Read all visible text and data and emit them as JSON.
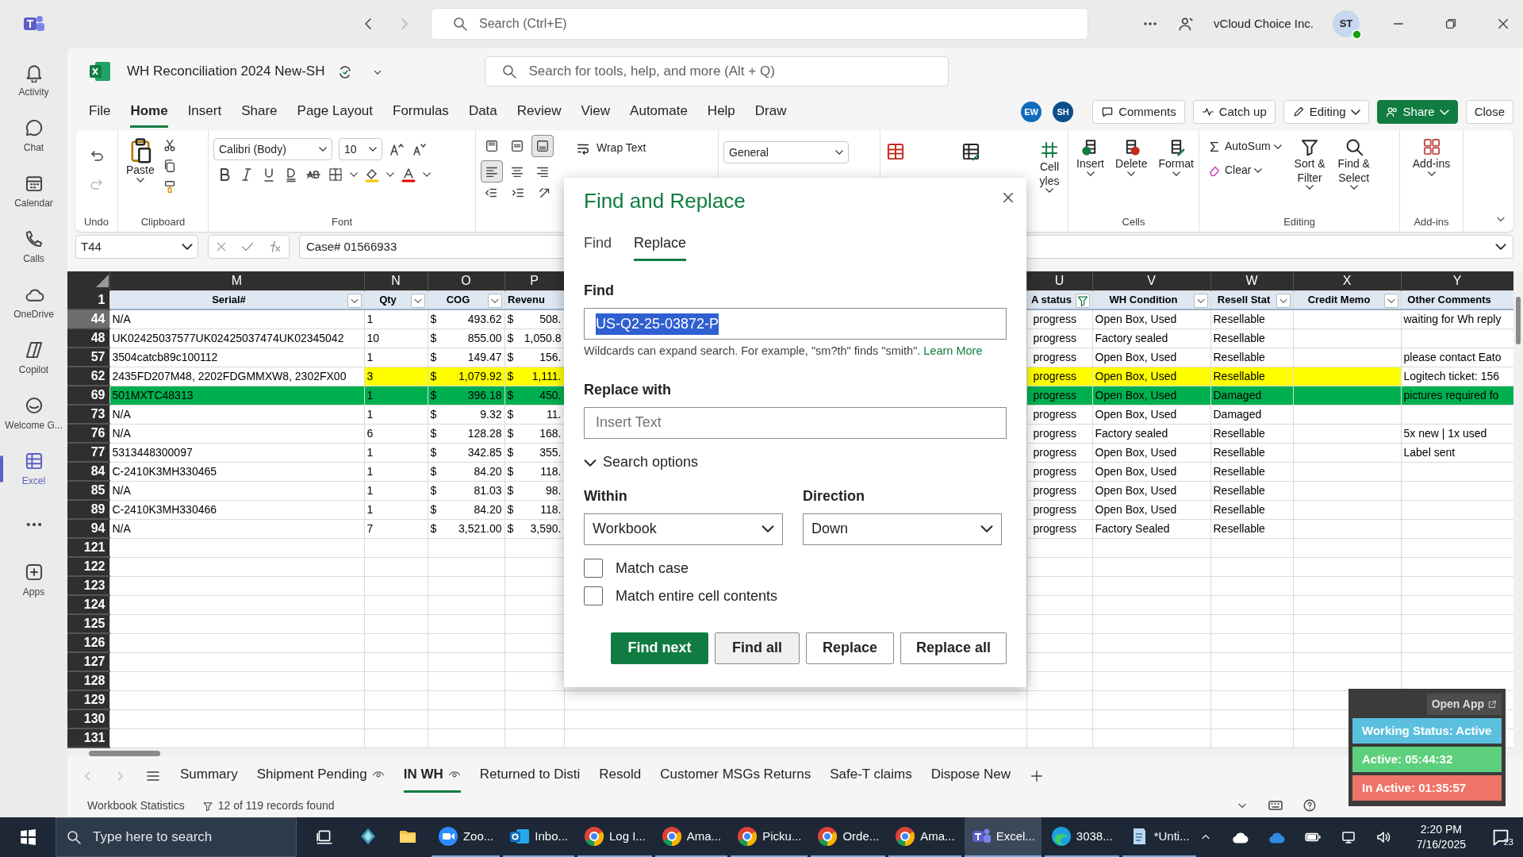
{
  "teams_titlebar": {
    "search_placeholder": "Search (Ctrl+E)",
    "organization": "vCloud Choice Inc.",
    "avatar": "ST"
  },
  "teams_rail": [
    {
      "kind": "app",
      "label": "Activity",
      "selected": false
    },
    {
      "kind": "app",
      "label": "Chat",
      "selected": false
    },
    {
      "kind": "app",
      "label": "Calendar",
      "selected": false
    },
    {
      "kind": "app",
      "label": "Calls",
      "selected": false
    },
    {
      "kind": "app",
      "label": "OneDrive",
      "selected": false
    },
    {
      "kind": "app",
      "label": "Copilot",
      "selected": false
    },
    {
      "kind": "app",
      "label": "Welcome G...",
      "selected": false
    },
    {
      "kind": "app",
      "label": "Excel",
      "selected": true
    },
    {
      "kind": "more",
      "selected": false
    },
    {
      "kind": "app",
      "label": "Apps",
      "selected": false
    }
  ],
  "file_bar": {
    "title": "WH Reconciliation 2024 New-SH",
    "search_placeholder": "Search for tools, help, and more (Alt + Q)"
  },
  "menu": [
    {
      "label": "File",
      "selected": false
    },
    {
      "label": "Home",
      "selected": true
    },
    {
      "label": "Insert",
      "selected": false
    },
    {
      "label": "Share",
      "selected": false
    },
    {
      "label": "Page Layout",
      "selected": false
    },
    {
      "label": "Formulas",
      "selected": false
    },
    {
      "label": "Data",
      "selected": false
    },
    {
      "label": "Review",
      "selected": false
    },
    {
      "label": "View",
      "selected": false
    },
    {
      "label": "Automate",
      "selected": false
    },
    {
      "label": "Help",
      "selected": false
    },
    {
      "label": "Draw",
      "selected": false
    }
  ],
  "collaborators": [
    {
      "initials": "EW",
      "color": "#0f6cbd"
    },
    {
      "initials": "SH",
      "color": "#0b4f8a"
    }
  ],
  "actions": [
    {
      "kind": "comments",
      "label": "Comments"
    },
    {
      "kind": "catchup",
      "label": "Catch up"
    },
    {
      "kind": "editing",
      "label": "Editing"
    },
    {
      "kind": "share",
      "label": "Share"
    },
    {
      "kind": "plain",
      "label": "Close"
    }
  ],
  "ribbon": {
    "undo": {
      "label": "Undo"
    },
    "clipboard": {
      "paste": "Paste",
      "label": "Clipboard"
    },
    "font": {
      "name": "Calibri (Body)",
      "size": "10",
      "label": "Font"
    },
    "alignment": {
      "wrap_text": "Wrap Text",
      "vertical": [
        {
          "selected": false
        },
        {
          "selected": false
        },
        {
          "selected": true
        }
      ],
      "horizontal": [
        {
          "selected": true
        },
        {
          "selected": false
        },
        {
          "selected": false
        }
      ]
    },
    "number": {
      "format": "General"
    },
    "styles": {
      "cell_styles": [
        "Cell",
        "yles"
      ]
    },
    "cells": {
      "buttons": [
        "Insert",
        "Delete",
        "Format"
      ],
      "label": "Cells"
    },
    "editing": {
      "autosum": "AutoSum",
      "clear": "Clear",
      "sort": [
        "Sort &",
        "Filter"
      ],
      "find": [
        "Find &",
        "Select"
      ],
      "label": "Editing"
    },
    "addins": {
      "button": "Add-ins",
      "label": "Add-ins"
    }
  },
  "formula_bar": {
    "name_box": "T44",
    "formula": "Case# 01566933"
  },
  "grid": {
    "columns": [
      {
        "letter": "M",
        "header": "Serial#",
        "filter_button": true,
        "filtered": false
      },
      {
        "letter": "N",
        "header": "Qty",
        "filter_button": true,
        "filtered": false
      },
      {
        "letter": "O",
        "header": "COG",
        "filter_button": true,
        "filtered": false
      },
      {
        "letter": "P",
        "header": "Revenu",
        "filter_button": false,
        "filtered": false
      },
      {
        "letter": "U",
        "header": "A status",
        "filter_button": true,
        "filtered": true
      },
      {
        "letter": "V",
        "header": "WH Condition",
        "filter_button": true,
        "filtered": false
      },
      {
        "letter": "W",
        "header": "Resell Stat",
        "filter_button": true,
        "filtered": false
      },
      {
        "letter": "X",
        "header": "Credit Memo",
        "filter_button": true,
        "filtered": false
      },
      {
        "letter": "Y",
        "header": "Other Comments",
        "filter_button": false,
        "filtered": false
      }
    ],
    "header_row": "1",
    "rows": [
      {
        "number": "44",
        "selected": true,
        "cells": [
          "N/A",
          "1",
          {
            "symbol": "$",
            "text": "493.62"
          },
          {
            "symbol": "$",
            "text": "508."
          },
          "progress",
          "Open Box, Used",
          "Resellable",
          null,
          "waiting for Wh reply"
        ]
      },
      {
        "number": "48",
        "selected": false,
        "cells": [
          "UK02425037577UK02425037474UK02345042",
          "10",
          {
            "symbol": "$",
            "text": "855.00"
          },
          {
            "symbol": "$",
            "text": "1,050.8"
          },
          "progress",
          "Factory sealed",
          "Resellable",
          null,
          null
        ]
      },
      {
        "number": "57",
        "selected": false,
        "cells": [
          "3504catcb89c100112",
          "1",
          {
            "symbol": "$",
            "text": "149.47"
          },
          {
            "symbol": "$",
            "text": "156."
          },
          "progress",
          "Open Box, Used",
          "Resellable",
          null,
          "please contact Eato"
        ]
      },
      {
        "number": "62",
        "selected": false,
        "cells": [
          "2435FD207M48, 2202FDGMMXW8, 2302FX00",
          {
            "text": "3",
            "color": "#ffff00"
          },
          {
            "symbol": "$",
            "text": "1,079.92",
            "color": "#ffff00"
          },
          {
            "symbol": "$",
            "text": "1,111.",
            "color": "#ffff00"
          },
          {
            "text": "progress",
            "color": "#ffff00"
          },
          {
            "text": "Open Box, Used",
            "color": "#ffff00"
          },
          {
            "text": "Resellable",
            "color": "#ffff00"
          },
          {
            "color": "#ffff00"
          },
          "Logitech ticket: 156"
        ]
      },
      {
        "number": "69",
        "selected": false,
        "cells": [
          {
            "text": "501MXTC48313",
            "color": "#00b050"
          },
          {
            "text": "1",
            "color": "#00b050"
          },
          {
            "symbol": "$",
            "text": "396.18",
            "color": "#00b050"
          },
          {
            "symbol": "$",
            "text": "450.",
            "color": "#00b050"
          },
          {
            "text": "progress",
            "color": "#00b050"
          },
          {
            "text": "Open Box, Used",
            "color": "#00b050"
          },
          {
            "text": "Damaged",
            "color": "#00b050"
          },
          {
            "color": "#00b050"
          },
          {
            "text": "pictures required fo",
            "color": "#00b050"
          }
        ]
      },
      {
        "number": "73",
        "selected": false,
        "cells": [
          "N/A",
          "1",
          {
            "symbol": "$",
            "text": "9.32"
          },
          {
            "symbol": "$",
            "text": "11."
          },
          "progress",
          "Open Box, Used",
          "Damaged",
          null,
          null
        ]
      },
      {
        "number": "76",
        "selected": false,
        "cells": [
          "N/A",
          "6",
          {
            "symbol": "$",
            "text": "128.28"
          },
          {
            "symbol": "$",
            "text": "168."
          },
          "progress",
          "Factory sealed",
          "Resellable",
          null,
          "5x new | 1x used"
        ]
      },
      {
        "number": "77",
        "selected": false,
        "cells": [
          "5313448300097",
          "1",
          {
            "symbol": "$",
            "text": "342.85"
          },
          {
            "symbol": "$",
            "text": "355."
          },
          "progress",
          "Open Box, Used",
          "Resellable",
          null,
          "Label sent"
        ]
      },
      {
        "number": "84",
        "selected": false,
        "cells": [
          "C-2410K3MH330465",
          "1",
          {
            "symbol": "$",
            "text": "84.20"
          },
          {
            "symbol": "$",
            "text": "118."
          },
          "progress",
          "Open Box, Used",
          "Resellable",
          null,
          null
        ]
      },
      {
        "number": "85",
        "selected": false,
        "cells": [
          "N/A",
          "1",
          {
            "symbol": "$",
            "text": "81.03"
          },
          {
            "symbol": "$",
            "text": "98."
          },
          "progress",
          "Open Box, Used",
          "Resellable",
          null,
          null
        ]
      },
      {
        "number": "89",
        "selected": false,
        "cells": [
          "C-2410K3MH330466",
          "1",
          {
            "symbol": "$",
            "text": "84.20"
          },
          {
            "symbol": "$",
            "text": "118."
          },
          "progress",
          "Open Box, Used",
          "Resellable",
          null,
          null
        ]
      },
      {
        "number": "94",
        "selected": false,
        "cells": [
          "N/A",
          "7",
          {
            "symbol": "$",
            "text": "3,521.00"
          },
          {
            "symbol": "$",
            "text": "3,590."
          },
          "progress",
          "Factory Sealed",
          "Resellable",
          null,
          null
        ]
      }
    ],
    "blank_rows": [
      "121",
      "122",
      "123",
      "124",
      "125",
      "126",
      "127",
      "128",
      "129",
      "130",
      "131"
    ]
  },
  "sheet_tabs": [
    {
      "label": "Summary",
      "selected": false,
      "watched": false
    },
    {
      "label": "Shipment Pending",
      "selected": false,
      "watched": true
    },
    {
      "label": "IN WH",
      "selected": true,
      "watched": true
    },
    {
      "label": "Returned to Disti",
      "selected": false,
      "watched": false
    },
    {
      "label": "Resold",
      "selected": false,
      "watched": false
    },
    {
      "label": "Customer MSGs Returns",
      "selected": false,
      "watched": false
    },
    {
      "label": "Safe-T claims",
      "selected": false,
      "watched": false
    },
    {
      "label": "Dispose New",
      "selected": false,
      "watched": false
    }
  ],
  "status_bar": {
    "statistics": "Workbook Statistics",
    "records": "12 of 119 records found"
  },
  "dialog": {
    "title": "Find and Replace",
    "tabs": [
      {
        "label": "Find",
        "selected": false
      },
      {
        "label": "Replace",
        "selected": true
      }
    ],
    "find": {
      "label": "Find",
      "value": "US-Q2-25-03872-P",
      "selected": true
    },
    "hint": "Wildcards can expand search. For example, \"sm?th\" finds \"smith\".",
    "hint_link": "Learn More",
    "replace": {
      "label": "Replace with",
      "placeholder": "Insert Text"
    },
    "search_options": {
      "label": "Search options",
      "expanded": true
    },
    "within": {
      "label": "Within",
      "value": "Workbook"
    },
    "direction": {
      "label": "Direction",
      "value": "Down"
    },
    "options": [
      {
        "label": "Match case",
        "checked": false
      },
      {
        "label": "Match entire cell contents",
        "checked": false
      }
    ],
    "buttons": [
      {
        "label": "Find next",
        "kind": "primary"
      },
      {
        "label": "Find all",
        "kind": "secondary"
      },
      {
        "label": "Replace",
        "kind": "default"
      },
      {
        "label": "Replace all",
        "kind": "default"
      }
    ]
  },
  "widget": {
    "open_app": "Open App",
    "statuses": [
      {
        "text": "Working Status: Active",
        "color": "#5bc0de"
      },
      {
        "text": "Active: 05:44:32",
        "color": "#5cd07c"
      },
      {
        "text": "In Active: 01:35:57",
        "color": "#ef7468"
      }
    ]
  },
  "taskbar": {
    "search_placeholder": "Type here to search",
    "apps": [
      {
        "kind": "launcher",
        "selected": false
      },
      {
        "kind": "folder",
        "selected": false
      },
      {
        "kind": "zoom",
        "label": "Zoo...",
        "selected": false
      },
      {
        "kind": "mail",
        "label": "Inbo...",
        "selected": false
      },
      {
        "kind": "chrome",
        "label": "Log I...",
        "selected": false
      },
      {
        "kind": "chrome",
        "label": "Ama...",
        "selected": false
      },
      {
        "kind": "chrome",
        "label": "Picku...",
        "selected": false
      },
      {
        "kind": "chrome",
        "label": "Orde...",
        "selected": false
      },
      {
        "kind": "chrome",
        "label": "Ama...",
        "selected": false
      },
      {
        "kind": "teams",
        "label": "Excel...",
        "selected": true
      },
      {
        "kind": "edge",
        "label": "3038...",
        "selected": false
      },
      {
        "kind": "notepad",
        "label": "*Unti...",
        "selected": false
      }
    ],
    "time": "2:20 PM",
    "date": "7/16/2025",
    "notifications": "23"
  }
}
